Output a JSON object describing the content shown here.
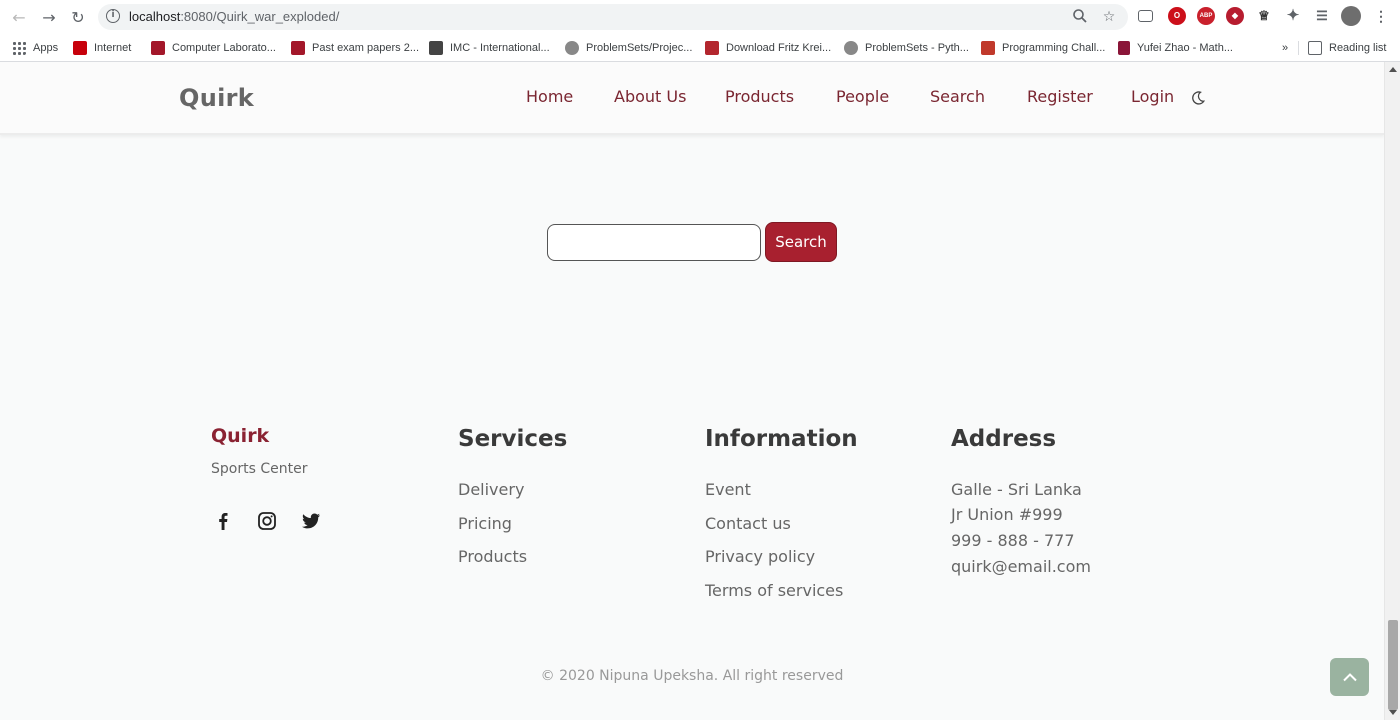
{
  "browser": {
    "url_host": "localhost",
    "url_rest": ":8080/Quirk_war_exploded/",
    "bookmarks": [
      {
        "label": "Apps",
        "color": "#5f6368"
      },
      {
        "label": "Internet",
        "color": "#c7000b"
      },
      {
        "label": "Computer Laborato...",
        "color": "#a3172a"
      },
      {
        "label": "Past exam papers 2...",
        "color": "#a3172a"
      },
      {
        "label": "IMC - International...",
        "color": "#444444"
      },
      {
        "label": "ProblemSets/Projec...",
        "color": "#888888"
      },
      {
        "label": "Download Fritz Krei...",
        "color": "#b3262e"
      },
      {
        "label": "ProblemSets - Pyth...",
        "color": "#888888"
      },
      {
        "label": "Programming Chall...",
        "color": "#c0392b"
      },
      {
        "label": "Yufei Zhao - Math...",
        "color": "#8a1538"
      }
    ],
    "more_bookmarks": "»",
    "reading_list": "Reading list"
  },
  "header": {
    "brand": "Quirk",
    "nav": [
      "Home",
      "About Us",
      "Products",
      "People",
      "Search",
      "Register",
      "Login"
    ]
  },
  "search": {
    "value": "",
    "button_label": "Search"
  },
  "footer": {
    "brand": "Quirk",
    "tagline": "Sports Center",
    "columns": [
      {
        "title": "Services",
        "links": [
          "Delivery",
          "Pricing",
          "Products"
        ]
      },
      {
        "title": "Information",
        "links": [
          "Event",
          "Contact us",
          "Privacy policy",
          "Terms of services"
        ]
      },
      {
        "title": "Address",
        "lines": [
          "Galle - Sri Lanka",
          "Jr Union #999",
          "999 - 888 - 777",
          "quirk@email.com"
        ]
      }
    ],
    "copyright": "© 2020 Nipuna Upeksha. All right reserved"
  },
  "colors": {
    "accent": "#a8202f",
    "nav_link": "#7a2631",
    "back_to_top": "#9ab3a0"
  },
  "icons": {
    "theme_toggle": "moon-icon",
    "social": [
      "facebook-icon",
      "instagram-icon",
      "twitter-icon"
    ],
    "back_to_top": "chevron-up-icon"
  }
}
